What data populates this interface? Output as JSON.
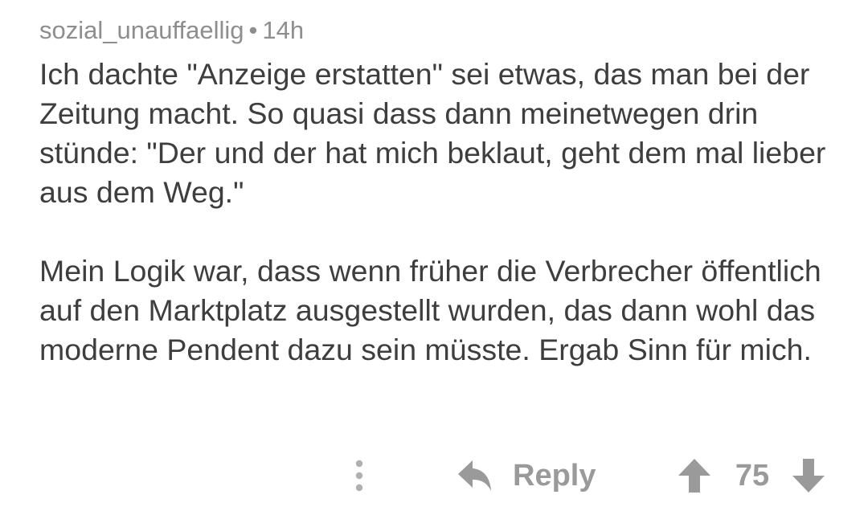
{
  "comment": {
    "username": "sozial_unauffaellig",
    "separator": "•",
    "age": "14h",
    "paragraphs": [
      "Ich dachte \"Anzeige erstatten\" sei etwas, das man bei der Zeitung macht. So quasi dass dann meinetwegen drin stünde: \"Der und der hat mich beklaut, geht dem mal lieber aus dem Weg.\"",
      "Mein Logik war, dass wenn früher die Verbrecher öffentlich auf den Marktplatz ausgestellt wurden, das dann wohl das moderne Pendent dazu sein müsste. Ergab Sinn für mich."
    ]
  },
  "actions": {
    "more_icon": "vertical-dots-icon",
    "reply_icon": "reply-arrow-icon",
    "reply_label": "Reply",
    "upvote_icon": "arrow-up-icon",
    "score": "75",
    "downvote_icon": "arrow-down-icon"
  },
  "colors": {
    "meta_text": "#8e8e8e",
    "body_text": "#3e3e3e",
    "action_text": "#9a9a9a",
    "background": "#ffffff"
  }
}
